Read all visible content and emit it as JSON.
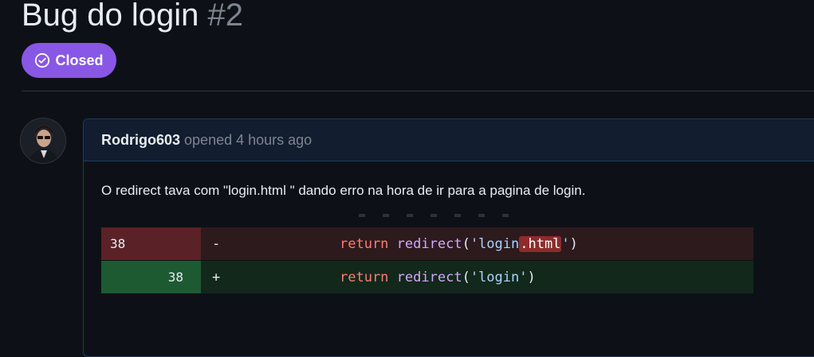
{
  "issue": {
    "title": "Bug do login",
    "number": "#2",
    "status": "Closed",
    "status_color": "#8957e5"
  },
  "comment": {
    "author": "Rodrigo603",
    "meta": "opened 4 hours ago",
    "body": "O redirect tava com \"login.html \" dando erro na hora de ir para a pagina de login.",
    "avatar_icon": "user-avatar-photo"
  },
  "diff": {
    "removed": {
      "line_number": "38",
      "sign": "-",
      "keyword": "return",
      "function": "redirect",
      "open": "(",
      "string_start": "'login",
      "string_highlight": ".html",
      "string_end": "'",
      "close": ")"
    },
    "added": {
      "line_number": "38",
      "sign": "+",
      "keyword": "return",
      "function": "redirect",
      "open": "(",
      "string": "'login'",
      "close": ")"
    }
  }
}
